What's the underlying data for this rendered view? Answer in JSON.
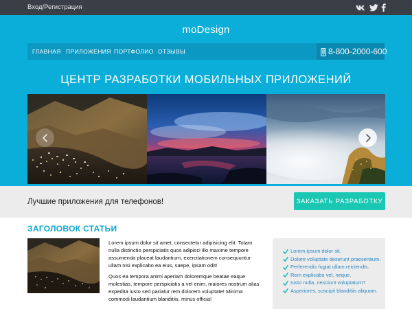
{
  "topbar": {
    "login_label": "Вход/Регистрация",
    "social_icons": [
      "vk-icon",
      "twitter-icon",
      "facebook-icon"
    ]
  },
  "header": {
    "logo": "moDesign",
    "nav": [
      {
        "label": "ГЛАВНАЯ"
      },
      {
        "label": "ПРИЛОЖЕНИЯ"
      },
      {
        "label": "ПОРТФОЛИО"
      },
      {
        "label": "ОТЗЫВЫ"
      }
    ],
    "phone": "8-800-2000-600",
    "hero_title": "ЦЕНТР РАЗРАБОТКИ МОБИЛЬНЫХ ПРИЛОЖЕНИЙ"
  },
  "slider": {
    "slides": [
      "mountain-town-photo",
      "sunset-lake-photo",
      "foggy-coast-photo"
    ],
    "prev_icon": "chevron-left-icon",
    "next_icon": "chevron-right-icon"
  },
  "cta": {
    "text": "Лучшие приложения для телефонов!",
    "button_label": "ЗАКАЗАТЬ РАЗРАБОТКУ"
  },
  "article": {
    "title": "ЗАГОЛОВОК СТАТЬИ",
    "paragraphs": [
      "Lorem ipsum dolor sit amet, consectetur adipisicing elit. Totam nulla distinctio perspiciatis quos adipisci illo maxime tempore assumenda placeat laudantium, exercitationem consequuntur ullam nisi explicabo ea eius, saepe, ipsam odit!",
      "Quos ea tempora animi aperiam doloremque beatae eaque molestias, tempore perspiciatis a vel enim, maiores nostrum alias expedita iusto sed pariatur rem dolorem voluptate! Minima commodi laudantium blanditiis, minus officia!"
    ]
  },
  "side_panel": {
    "items": [
      "Lorem ipsum dolor sit.",
      "Dolore voluptate deserunt praesentium.",
      "Perferendis fugiat ullam reiciendis.",
      "Rem explicabo vel, neque.",
      "Iusto nulla, nesciunt voluptatum?",
      "Asperiores, suscipit blanditiis aliquam."
    ]
  },
  "colors": {
    "header_blue": "#0aaed8",
    "nav_blue": "#0b98c3",
    "cta_teal": "#19c7b3",
    "title_blue": "#0aa8d4",
    "topbar_dark": "#3a3f47"
  }
}
